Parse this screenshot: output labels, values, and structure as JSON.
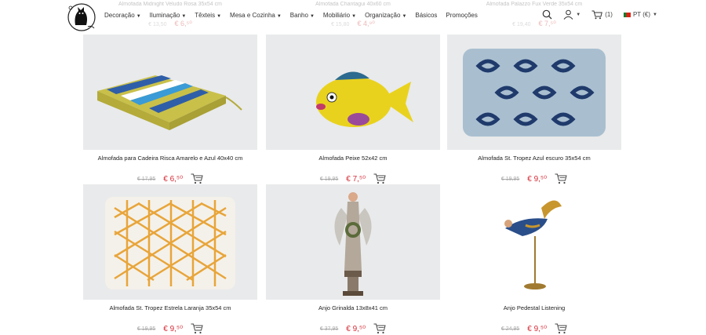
{
  "ghost_row": [
    {
      "name": "Almofada Midnight Veludo Rosa 35x54 cm",
      "old": "€ 13,50",
      "price": "€ 6,⁵⁰"
    },
    {
      "name": "Almofada Chantagui 40x60 cm",
      "old": "€ 15,80",
      "price": "€ 4,⁹⁰"
    },
    {
      "name": "Almofada Palazzo Fux Verde 35x54 cm",
      "old": "€ 19,40",
      "price": "€ 7,⁵⁰"
    }
  ],
  "nav": {
    "items": [
      "Decoração",
      "Iluminação",
      "Têxteis",
      "Mesa e Cozinha",
      "Banho",
      "Mobiliário",
      "Organização",
      "Básicos",
      "Promoções"
    ],
    "carets": [
      true,
      true,
      true,
      true,
      true,
      true,
      true,
      false,
      false
    ]
  },
  "tools": {
    "cart_count": "(1)",
    "language": "PT (€)"
  },
  "products": [
    {
      "name": "Almofada para Cadeira Risca Amarelo e Azul 40x40 cm",
      "old_price": "€ 17,95",
      "price": "€ 6,⁵⁰",
      "icon": "yellow-blue-striped-cushion"
    },
    {
      "name": "Almofada Peixe 52x42 cm",
      "old_price": "€ 19,95",
      "price": "€ 7,⁵⁰",
      "icon": "fish-cushion"
    },
    {
      "name": "Almofada St. Tropez Azul escuro 35x54 cm",
      "old_price": "€ 19,95",
      "price": "€ 9,⁵⁰",
      "icon": "blue-pattern-cushion"
    },
    {
      "name": "Almofada St. Tropez Estrela Laranja 35x54 cm",
      "old_price": "€ 19,95",
      "price": "€ 9,⁵⁰",
      "icon": "orange-star-cushion"
    },
    {
      "name": "Anjo Grinalda 13x8x41 cm",
      "old_price": "€ 37,95",
      "price": "€ 9,⁵⁰",
      "icon": "angel-wreath-figure"
    },
    {
      "name": "Anjo Pedestal Listening",
      "old_price": "€ 24,95",
      "price": "€ 9,⁵⁰",
      "icon": "angel-pedestal-figure"
    }
  ],
  "colors": {
    "price_red": "#d42c36",
    "bg_image": "#e9eaeb"
  }
}
